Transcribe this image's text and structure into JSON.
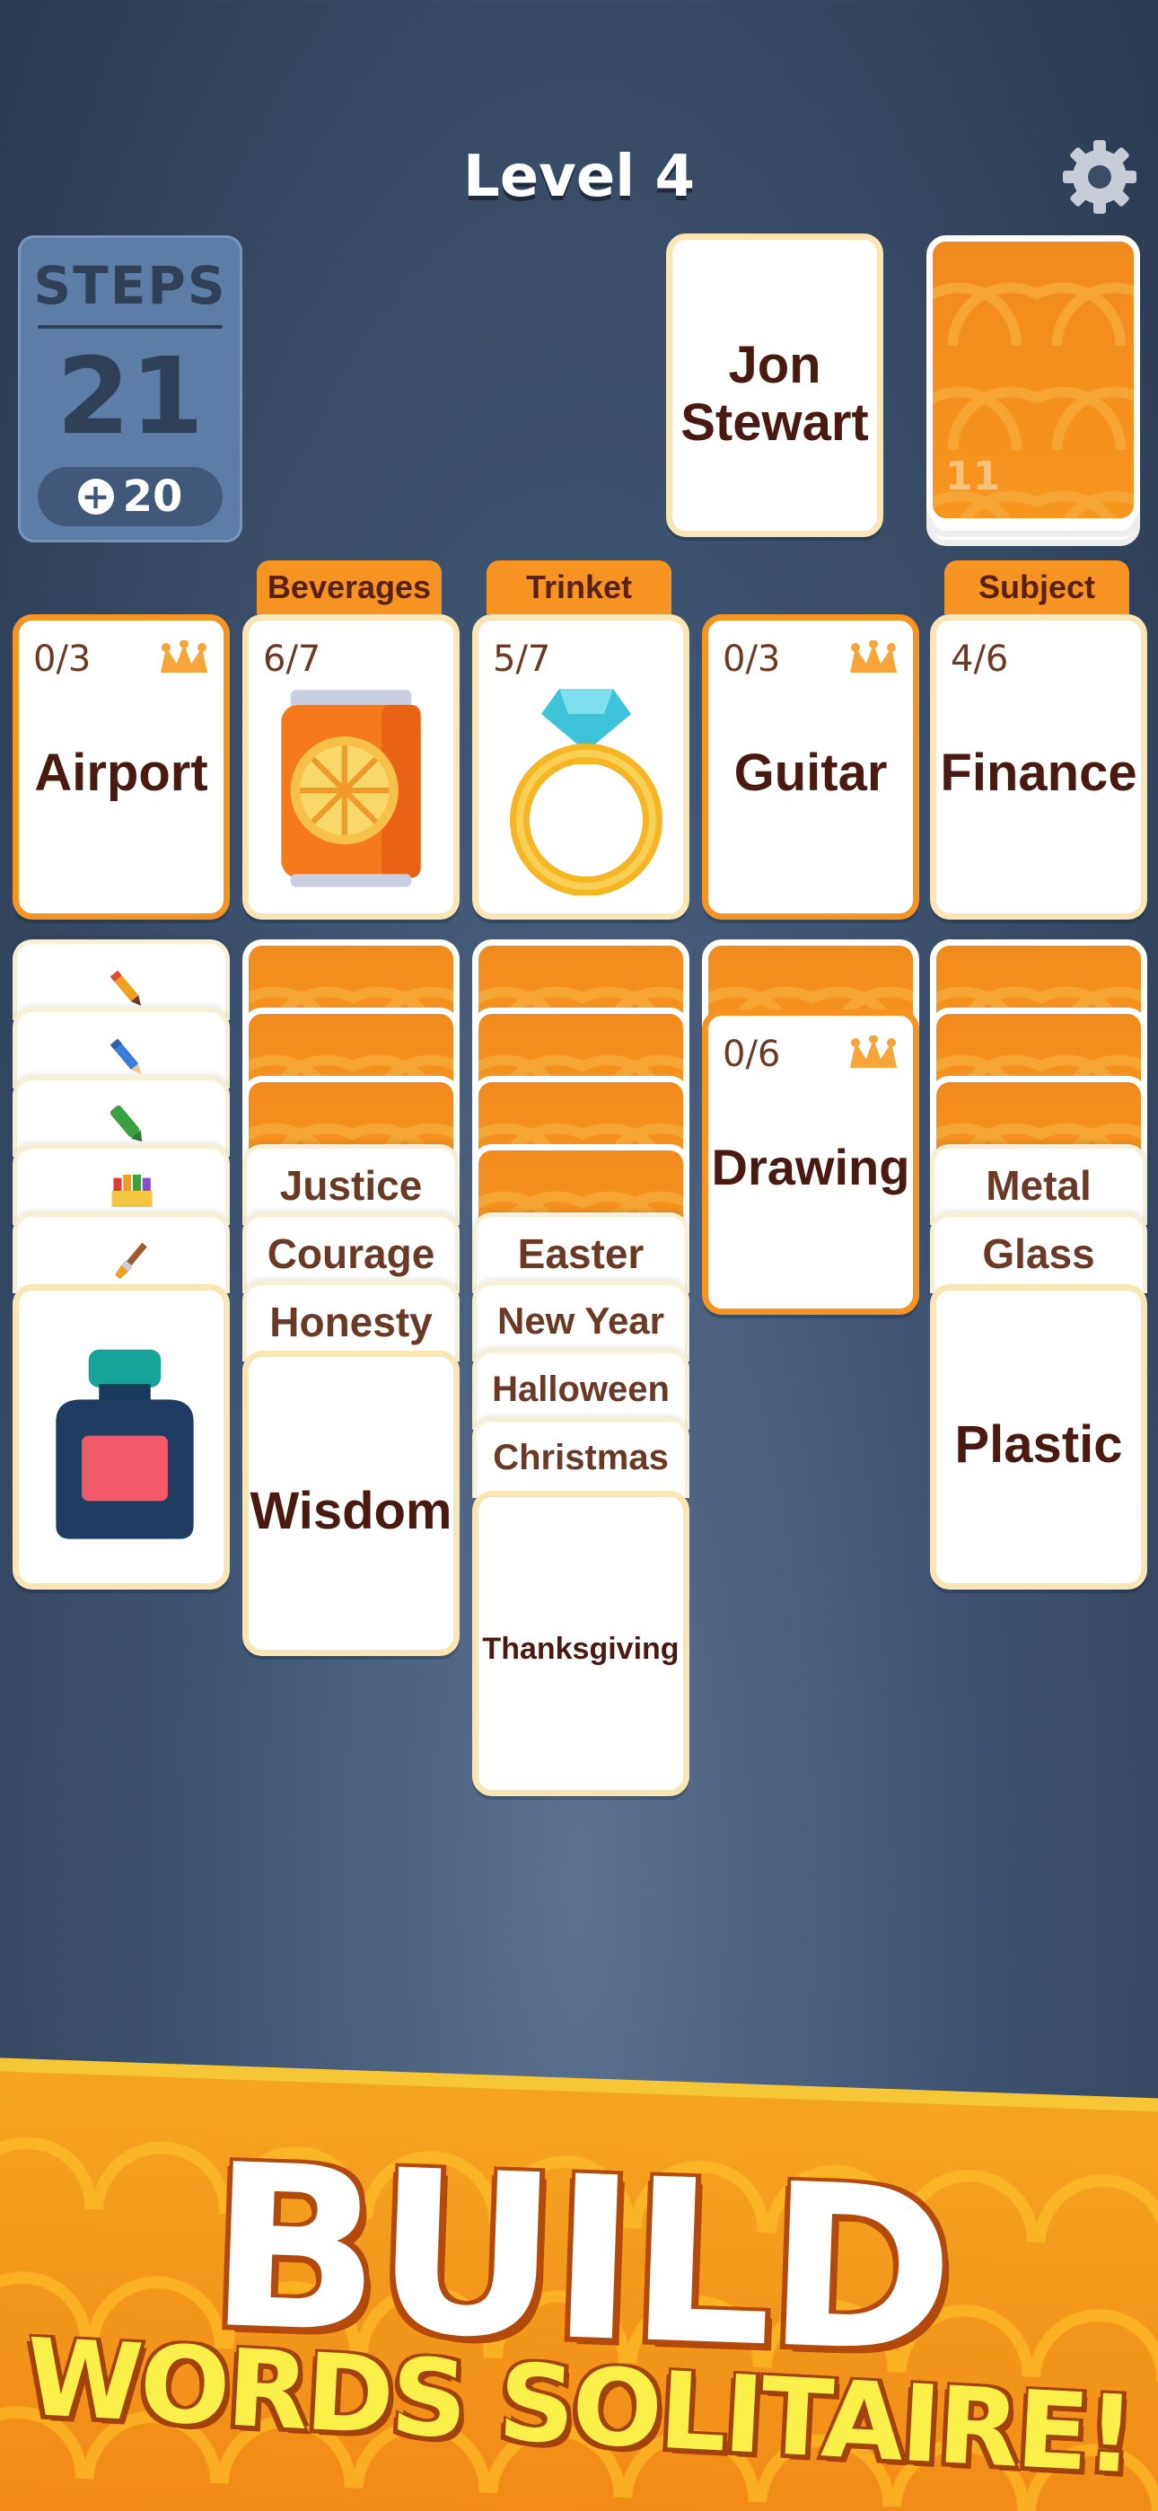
{
  "header": {
    "level_title": "Level 4",
    "settings_icon": "gear-icon"
  },
  "steps": {
    "label": "STEPS",
    "value": "21",
    "bonus_icon": "plus-icon",
    "bonus": "20"
  },
  "draw_pile": {
    "face_up_word": "Jon Stewart",
    "face_up_line1": "Jon",
    "face_up_line2": "Stewart",
    "remaining": "11"
  },
  "foundations": [
    {
      "category": "",
      "count": "0/3",
      "word": "Airport",
      "icon": "jester-hat-icon"
    },
    {
      "category": "Beverages",
      "count": "6/7",
      "image": "juice-can-icon"
    },
    {
      "category": "Trinket",
      "count": "5/7",
      "image": "diamond-ring-icon"
    },
    {
      "category": "",
      "count": "0/3",
      "word": "Guitar",
      "icon": "jester-hat-icon"
    },
    {
      "category": "Subject",
      "count": "4/6",
      "word": "Finance"
    }
  ],
  "tableau": {
    "col1": {
      "icons": [
        "pencil-icon",
        "blue-pencil-icon",
        "green-marker-icon",
        "crayons-icon",
        "paintbrush-icon"
      ],
      "top_image": "ink-bottle-icon"
    },
    "col2": {
      "stack": [
        "Justice",
        "Courage",
        "Honesty"
      ],
      "top": "Wisdom"
    },
    "col3": {
      "stack": [
        "Easter",
        "New Year",
        "Halloween",
        "Christmas"
      ],
      "top": "Thanksgiving"
    },
    "col4": {
      "category_count": "0/6",
      "category_word": "Drawing",
      "icon": "jester-hat-icon"
    },
    "col5": {
      "stack": [
        "Metal",
        "Glass"
      ],
      "top": "Plastic"
    }
  },
  "banner": {
    "line1": "BUILD",
    "line2": "WORDS SOLITAIRE!"
  }
}
